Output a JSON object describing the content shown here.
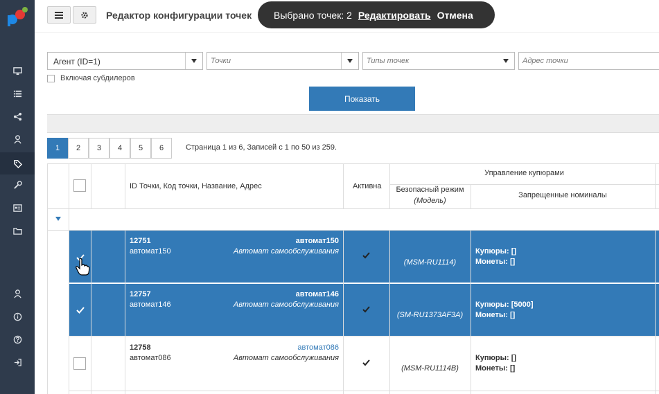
{
  "page": {
    "title": "Редактор конфигурации точек"
  },
  "toast": {
    "selected_text": "Выбрано точек: 2",
    "edit_link": "Редактировать",
    "cancel_link": "Отмена"
  },
  "filters": {
    "agent_value": "Агент (ID=1)",
    "points_placeholder": "Точки",
    "point_types_placeholder": "Типы точек",
    "address_placeholder": "Адрес точки",
    "include_subdealers_label": "Включая субдилеров",
    "show_button": "Показать"
  },
  "pagination": {
    "pages": [
      "1",
      "2",
      "3",
      "4",
      "5",
      "6"
    ],
    "active_page": "1",
    "info": "Страница 1 из 6, Записей с 1 по 50 из 259."
  },
  "table": {
    "headers": {
      "id_code_name_address": "ID Точки,  Код точки,  Название,  Адрес",
      "active": "Активна",
      "banknote_management": "Управление купюрами",
      "safe_mode": "Безопасный режим",
      "model": "(Модель)",
      "forbidden_denominations": "Запрещенные номиналы"
    },
    "rows": [
      {
        "id": "12751",
        "code": "автомат150",
        "name": "автомат150",
        "address": "Автомат самообслуживания",
        "model": "(MSM-RU1114)",
        "banknotes": "Купюры: []",
        "coins": "Монеты: []",
        "selected": true
      },
      {
        "id": "12757",
        "code": "автомат146",
        "name": "автомат146",
        "address": "Автомат самообслуживания",
        "model": "(SM-RU1373AF3A)",
        "banknotes": "Купюры: [5000]",
        "coins": "Монеты: []",
        "selected": true
      },
      {
        "id": "12758",
        "code": "автомат086",
        "name": "автомат086",
        "address": "Автомат самообслуживания",
        "model": "(MSM-RU1114B)",
        "banknotes": "Купюры: []",
        "coins": "Монеты: []",
        "selected": false
      }
    ]
  },
  "colors": {
    "sidebar": "#2f3b4c",
    "accent": "#337ab7",
    "toast": "#333333"
  },
  "sidebar_icons": [
    "monitor-icon",
    "list-icon",
    "share-icon",
    "user-network-icon",
    "tag-icon",
    "wrench-icon",
    "id-card-icon",
    "folder-icon",
    "user-network-icon",
    "info-icon",
    "help-icon",
    "logout-icon"
  ]
}
